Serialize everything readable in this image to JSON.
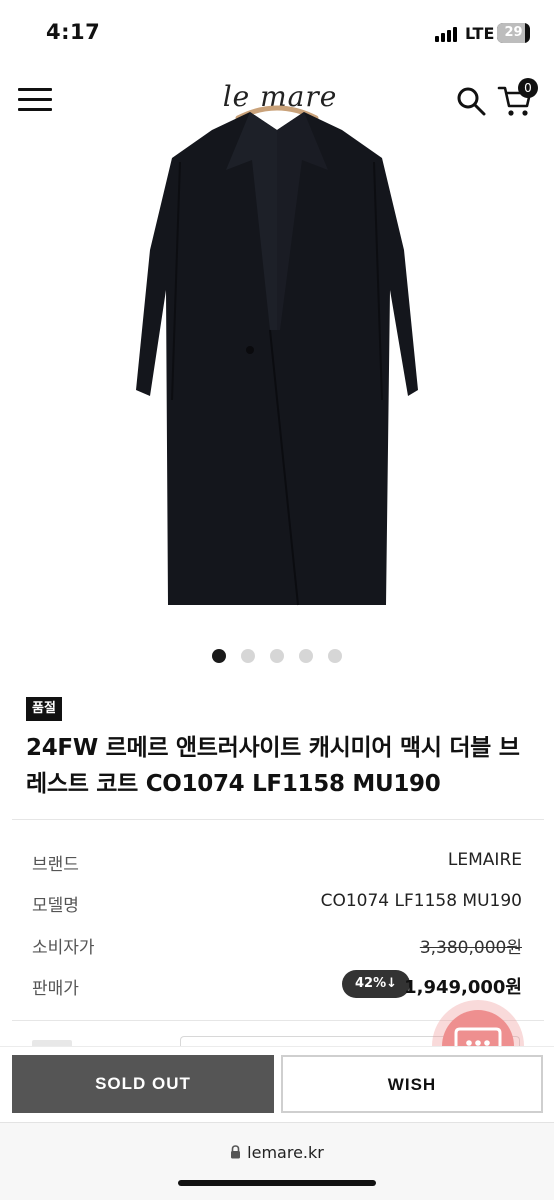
{
  "status_bar": {
    "time": "4:17",
    "network": "LTE",
    "battery": "29"
  },
  "header": {
    "logo": "le mare",
    "cart_count": "0",
    "icons": [
      "menu-icon",
      "search-icon",
      "cart-icon"
    ]
  },
  "gallery": {
    "image_description": "black double-breasted long coat on hanger",
    "slide_count": 5,
    "active_index": 0
  },
  "product": {
    "badge": "품절",
    "title": "24FW 르메르 앤트러사이트 캐시미어 맥시 더블 브레스트 코트 CO1074 LF1158 MU190"
  },
  "info": [
    {
      "label": "브랜드",
      "value": "LEMAIRE"
    },
    {
      "label": "모델명",
      "value": "CO1074 LF1158 MU190"
    },
    {
      "label": "소비자가",
      "value": "3,380,000원"
    },
    {
      "label": "판매가",
      "discount": "42%↓",
      "value": "1,949,000원"
    }
  ],
  "actions": {
    "soldout": "SOLD OUT",
    "wish": "WISH"
  },
  "browser": {
    "url": "lemare.kr"
  },
  "colors": {
    "accent_dark": "#111111",
    "soldout_button": "#555555",
    "chat_fab": "#ee8f8f"
  }
}
